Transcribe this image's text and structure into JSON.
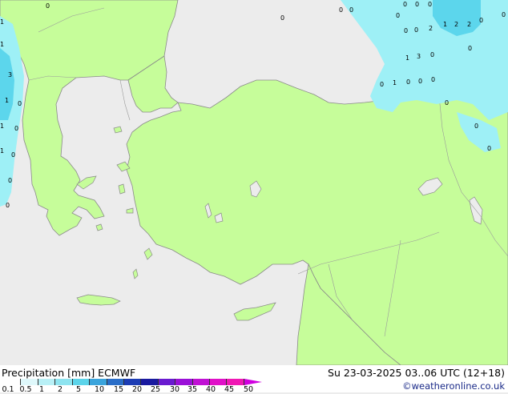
{
  "colors": {
    "sea": "#ececec",
    "land": "#c6fd9a",
    "coast": "#8a8a8a",
    "precip_light": "#9ef0f6",
    "precip_medium": "#5cd6ec",
    "credit": "#1a2a88"
  },
  "footer": {
    "title": "Precipitation [mm] ECMWF",
    "datetime": "Su 23-03-2025 03..06 UTC (12+18)",
    "credit": "©weatheronline.co.uk"
  },
  "legend": {
    "labels": [
      "0.1",
      "0.5",
      "1",
      "2",
      "5",
      "10",
      "15",
      "20",
      "25",
      "30",
      "35",
      "40",
      "45",
      "50"
    ],
    "colors": [
      "#ffffff",
      "#dff8fb",
      "#b8f0f6",
      "#8ee4f0",
      "#5cd4ea",
      "#3aa4dc",
      "#2a6ec8",
      "#1c3cb4",
      "#1a1aa0",
      "#6a1ad0",
      "#9a10d8",
      "#c010d4",
      "#e010c8",
      "#f018b4"
    ]
  },
  "map_labels": [
    {
      "id": "p1",
      "text": "0"
    },
    {
      "id": "p2",
      "text": "0"
    },
    {
      "id": "p3",
      "text": "0"
    },
    {
      "id": "p4",
      "text": "0"
    },
    {
      "id": "p5",
      "text": "0"
    },
    {
      "id": "p6",
      "text": "0"
    },
    {
      "id": "p7",
      "text": "0"
    },
    {
      "id": "p8",
      "text": "0"
    },
    {
      "id": "p9",
      "text": "2"
    },
    {
      "id": "p10",
      "text": "1"
    },
    {
      "id": "p11",
      "text": "2"
    },
    {
      "id": "p12",
      "text": "2"
    },
    {
      "id": "p13",
      "text": "0"
    },
    {
      "id": "p14",
      "text": "0"
    },
    {
      "id": "p15",
      "text": "1"
    },
    {
      "id": "p16",
      "text": "3"
    },
    {
      "id": "p17",
      "text": "0"
    },
    {
      "id": "p18",
      "text": "0"
    },
    {
      "id": "p19",
      "text": "0"
    },
    {
      "id": "p20",
      "text": "1"
    },
    {
      "id": "p21",
      "text": "0"
    },
    {
      "id": "p22",
      "text": "0"
    },
    {
      "id": "p23",
      "text": "0"
    },
    {
      "id": "p24",
      "text": "0"
    },
    {
      "id": "p25",
      "text": "0"
    },
    {
      "id": "p26",
      "text": "0"
    },
    {
      "id": "p27",
      "text": "0"
    },
    {
      "id": "p28",
      "text": "0"
    },
    {
      "id": "p29",
      "text": "1"
    },
    {
      "id": "p30",
      "text": "1"
    },
    {
      "id": "p31",
      "text": "3"
    },
    {
      "id": "p32",
      "text": "0"
    },
    {
      "id": "p33",
      "text": "1"
    },
    {
      "id": "p34",
      "text": "0"
    },
    {
      "id": "p35",
      "text": "1"
    },
    {
      "id": "p36",
      "text": "0"
    },
    {
      "id": "p37",
      "text": "1"
    },
    {
      "id": "p38",
      "text": "0"
    },
    {
      "id": "p39",
      "text": "0"
    }
  ]
}
